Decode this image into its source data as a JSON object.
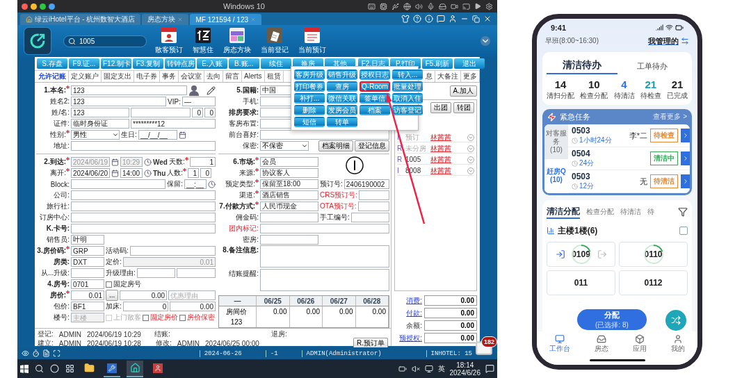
{
  "mac_bar": {
    "title": "Windows 10"
  },
  "app_tabs": [
    {
      "label": "绿云iHotel平台 - 杭州数智大酒店",
      "selected": false
    },
    {
      "label": "房态方块",
      "selected": false
    },
    {
      "label": "MF 121594 / 123",
      "selected": true
    }
  ],
  "header": {
    "search": "1005",
    "apps": [
      "散客预订",
      "智慧住",
      "房态方块",
      "当前登记",
      "当前预订"
    ]
  },
  "toolbar": {
    "left": [
      "S.存盘",
      "F9.证...",
      "F12.制卡",
      "F3.复制",
      "转钟点房",
      "E.入账",
      "B.账...",
      "续住",
      "换房",
      "其他"
    ],
    "right": [
      "F2.日志",
      "P.打印",
      "F5.刷新",
      "退出"
    ]
  },
  "subtabs": {
    "left": [
      {
        "label": "允许记账",
        "selected": true
      },
      {
        "label": "定义账户",
        "selected": false
      },
      {
        "label": "固定支出",
        "selected": false
      },
      {
        "label": "电子券",
        "selected": false
      },
      {
        "label": "事务",
        "selected": false
      },
      {
        "label": "会议室",
        "selected": false
      },
      {
        "label": "去向",
        "selected": false
      },
      {
        "label": "留言",
        "selected": false
      },
      {
        "label": "Alerts",
        "selected": false
      },
      {
        "label": "租赁",
        "selected": false
      }
    ],
    "right": [
      {
        "label": "息",
        "selected": false
      },
      {
        "label": "大备注",
        "selected": false
      },
      {
        "label": "更多",
        "selected": false
      }
    ]
  },
  "form": {
    "left": [
      [
        [
          {
            "kind": "label",
            "text": "1.本名:",
            "bold": true,
            "required": true
          },
          {
            "kind": "input",
            "value": "123"
          },
          {
            "kind": "avatar"
          },
          {
            "kind": "pen"
          }
        ],
        [
          {
            "kind": "label",
            "text": "姓名2:"
          },
          {
            "kind": "input",
            "value": "123"
          },
          {
            "kind": "label",
            "text": "VIP:"
          },
          {
            "kind": "short",
            "value": "—"
          }
        ],
        [
          {
            "kind": "label",
            "text": "姓/名:"
          },
          {
            "kind": "medium",
            "value": "123"
          },
          {
            "kind": "input"
          },
          {
            "kind": "num",
            "value": "0"
          },
          {
            "kind": "num",
            "value": "0"
          }
        ],
        [
          {
            "kind": "label",
            "text": "证件:"
          },
          {
            "kind": "medium",
            "value": "临时身份证"
          },
          {
            "kind": "input",
            "value": "*********12"
          }
        ],
        [
          {
            "kind": "label",
            "text": "性别:",
            "required": true
          },
          {
            "kind": "select",
            "value": "男性"
          },
          {
            "kind": "label",
            "text": "生日:"
          },
          {
            "kind": "date",
            "value": "__/__/__"
          },
          {
            "kind": "calendar"
          }
        ],
        [
          {
            "kind": "label",
            "text": "地址:"
          },
          {
            "kind": "input"
          }
        ]
      ],
      [
        [
          {
            "kind": "label",
            "text": "2.到达:",
            "bold": true,
            "required": true
          },
          {
            "kind": "date",
            "value": "2024/06/19",
            "disabled": true
          },
          {
            "kind": "calendar"
          },
          {
            "kind": "time",
            "value": "10:29",
            "disabled": true
          },
          {
            "kind": "clock"
          },
          {
            "kind": "text",
            "text": "Wed"
          },
          {
            "kind": "label",
            "text": "天数:",
            "required": true
          },
          {
            "kind": "amount",
            "value": "1"
          }
        ],
        [
          {
            "kind": "label",
            "text": "离开:",
            "required": true
          },
          {
            "kind": "date",
            "value": "2024/06/20"
          },
          {
            "kind": "calendar"
          },
          {
            "kind": "time",
            "value": "14:00"
          },
          {
            "kind": "clock"
          },
          {
            "kind": "text",
            "text": "Thu"
          },
          {
            "kind": "label",
            "text": "人数:",
            "required": true
          },
          {
            "kind": "num",
            "value": "1"
          },
          {
            "kind": "num",
            "value": "0"
          }
        ],
        [
          {
            "kind": "label",
            "text": "Block:"
          },
          {
            "kind": "input"
          },
          {
            "kind": "label",
            "text": "保留:"
          },
          {
            "kind": "time",
            "value": "__:__"
          },
          {
            "kind": "clock"
          }
        ],
        [
          {
            "kind": "label",
            "text": "公司:"
          },
          {
            "kind": "input"
          }
        ],
        [
          {
            "kind": "label",
            "text": "旅行社:"
          },
          {
            "kind": "input"
          }
        ],
        [
          {
            "kind": "label",
            "text": "订房中心:"
          },
          {
            "kind": "input"
          }
        ],
        [
          {
            "kind": "label",
            "text": "K.卡号:",
            "bold": true
          },
          {
            "kind": "input"
          }
        ],
        [
          {
            "kind": "label",
            "text": "销售员:"
          },
          {
            "kind": "short",
            "value": "叶明"
          }
        ],
        [
          {
            "kind": "label",
            "text": "3.房价码:",
            "bold": true,
            "required": true
          },
          {
            "kind": "short",
            "value": "GRP"
          },
          {
            "kind": "label",
            "text": "活动码:"
          },
          {
            "kind": "input"
          }
        ],
        [
          {
            "kind": "label",
            "text": "房类:",
            "bold": true
          },
          {
            "kind": "short",
            "value": "DXT"
          },
          {
            "kind": "label",
            "text": "定价:"
          },
          {
            "kind": "amount",
            "value": "0.01",
            "disabled": true
          }
        ],
        [
          {
            "kind": "label",
            "text": "从...升级:"
          },
          {
            "kind": "short"
          },
          {
            "kind": "label",
            "text": "升级理由:"
          },
          {
            "kind": "input"
          },
          {
            "kind": "input"
          }
        ],
        [
          {
            "kind": "label",
            "text": "4.房号:",
            "bold": true
          },
          {
            "kind": "short",
            "value": "0701"
          },
          {
            "kind": "check",
            "label": "固定房号",
            "checked": false
          }
        ],
        [
          {
            "kind": "label",
            "text": "房价:",
            "bold": true,
            "required": true
          },
          {
            "kind": "short_amount",
            "value": "0.01"
          },
          {
            "kind": "button",
            "text": "..."
          },
          {
            "kind": "amount",
            "value": "0.00"
          },
          {
            "kind": "input",
            "placeholder": "优惠理由"
          }
        ],
        [
          {
            "kind": "label",
            "text": "包价:"
          },
          {
            "kind": "short",
            "value": "BF1"
          },
          {
            "kind": "label",
            "text": "加床:"
          },
          {
            "kind": "amount",
            "value": "0"
          },
          {
            "kind": "amount",
            "value": "0.00"
          }
        ],
        [
          {
            "kind": "label",
            "text": "楼号:"
          },
          {
            "kind": "short",
            "placeholder": "主楼",
            "disabled": true
          },
          {
            "kind": "check",
            "label": "上门散客",
            "checked": false,
            "disabled": true
          },
          {
            "kind": "check",
            "label": "固定房价",
            "checked": false,
            "red": true
          },
          {
            "kind": "check",
            "label": "房价保密",
            "checked": false,
            "red": true
          }
        ]
      ]
    ],
    "middle": [
      [
        [
          {
            "kind": "label",
            "text": "5.国籍:",
            "bold": true
          },
          {
            "kind": "input",
            "value": "中国"
          }
        ],
        [
          {
            "kind": "label",
            "text": "手机:"
          },
          {
            "kind": "input"
          }
        ],
        [
          {
            "kind": "label",
            "text": "排房要求:",
            "bold": true
          },
          {
            "kind": "input"
          }
        ],
        [
          {
            "kind": "label",
            "text": "客房布置:"
          },
          {
            "kind": "input"
          }
        ],
        [
          {
            "kind": "label",
            "text": "前台喜好:"
          },
          {
            "kind": "input"
          }
        ],
        [
          {
            "kind": "label",
            "text": "保密:"
          },
          {
            "kind": "select",
            "value": "不保密"
          },
          {
            "kind": "spacer"
          },
          {
            "kind": "button",
            "text": "档案明细"
          },
          {
            "kind": "button",
            "text": "登记信息"
          }
        ]
      ],
      [
        [
          {
            "kind": "label",
            "text": "6.市场:",
            "bold": true,
            "required": true
          },
          {
            "kind": "medium",
            "value": "会员"
          },
          {
            "kind": "spacer"
          },
          {
            "kind": "circle"
          },
          {
            "kind": "spacer"
          }
        ],
        [
          {
            "kind": "label",
            "text": "来源:",
            "required": true
          },
          {
            "kind": "medium",
            "value": "协议客人"
          }
        ],
        [
          {
            "kind": "label",
            "text": "预定类型:",
            "required": true
          },
          {
            "kind": "medium",
            "value": "保留至18:00"
          },
          {
            "kind": "label",
            "text": "预订号:"
          },
          {
            "kind": "input",
            "value": "2406190002"
          }
        ],
        [
          {
            "kind": "label",
            "text": "渠道:",
            "required": true
          },
          {
            "kind": "medium",
            "value": "酒店销售"
          },
          {
            "kind": "label",
            "text": "CRS预订号:",
            "red": true
          },
          {
            "kind": "input"
          }
        ],
        [
          {
            "kind": "label",
            "text": "7.付款方式:",
            "bold": true,
            "required": true
          },
          {
            "kind": "medium",
            "value": "人民币现金"
          },
          {
            "kind": "label",
            "text": "OTA预订号:",
            "red": true
          },
          {
            "kind": "input"
          }
        ],
        [
          {
            "kind": "label",
            "text": "佣金码:"
          },
          {
            "kind": "medium"
          },
          {
            "kind": "label",
            "text": "手工编号:"
          },
          {
            "kind": "input"
          }
        ],
        [
          {
            "kind": "label",
            "text": "团内标记:",
            "red": true
          },
          {
            "kind": "input"
          }
        ],
        [
          {
            "kind": "label",
            "text": "密房:"
          },
          {
            "kind": "medium"
          }
        ],
        [
          {
            "kind": "label",
            "text": "8.备注信息:",
            "bold": true
          },
          {
            "kind": "textarea"
          }
        ],
        [
          {
            "kind": "label",
            "text": "结账提醒:"
          },
          {
            "kind": "textarea"
          }
        ]
      ]
    ],
    "rate_table": {
      "columns": [
        "—",
        "06/25",
        "06/26",
        "06/27",
        "06/28"
      ],
      "rows": [
        [
          "房间价",
          "0.00",
          "0.00",
          "0.00",
          "0.00"
        ],
        [
          "123"
        ]
      ]
    },
    "footer": {
      "rows": [
        [
          {
            "label": "登记:",
            "user": "ADMIN",
            "time": "2024/06/19 10:29"
          },
          {
            "label": "结账:"
          },
          {
            "label": "退房:"
          }
        ],
        [
          {
            "label": "建立:",
            "user": "ADMIN",
            "time": "2024/06/19 10:28"
          },
          {
            "label": "修改:",
            "user": "ADMIN",
            "time": "2024/06/25 00:00"
          }
        ]
      ],
      "button": "R.预订单"
    }
  },
  "side_panel": {
    "add_button": "A.加人",
    "group_buttons": [
      "出团",
      "转团"
    ],
    "members": [
      {
        "code": "I",
        "room": "预订",
        "name": "林茜茜",
        "disabled": true
      },
      {
        "code": "R",
        "room": "未分房",
        "name": "林茜茜",
        "disabled": true
      },
      {
        "code": "R",
        "room": "1005",
        "name": "林茜茜",
        "disabled": false
      },
      {
        "code": "I",
        "room": "8008",
        "name": "林茜茜",
        "disabled": false
      }
    ],
    "totals": [
      {
        "label": "消费:",
        "value": "0.00",
        "link": true
      },
      {
        "label": "付款:",
        "value": "0.00",
        "link": true
      },
      {
        "label": "余额:",
        "value": "0.00",
        "link": false
      },
      {
        "label": "预授权:",
        "value": "0.00",
        "link": true
      }
    ]
  },
  "popup": [
    {
      "label": "客房升级",
      "highlighted": false
    },
    {
      "label": "销售升级",
      "highlighted": false
    },
    {
      "label": "授权日志",
      "highlighted": false
    },
    {
      "label": "转入...",
      "highlighted": false
    },
    {
      "label": "打印餐券",
      "highlighted": false
    },
    {
      "label": "查房",
      "highlighted": false
    },
    {
      "label": "Q-Room",
      "highlighted": true
    },
    {
      "label": "批量处理",
      "highlighted": false
    },
    {
      "label": "补打...",
      "highlighted": false
    },
    {
      "label": "微信关联",
      "highlighted": false
    },
    {
      "label": "签单信",
      "highlighted": false
    },
    {
      "label": "取消入住",
      "highlighted": false
    },
    {
      "label": "删除",
      "highlighted": false
    },
    {
      "label": "发房会员",
      "highlighted": false
    },
    {
      "label": "档案",
      "highlighted": false
    },
    {
      "label": "访客登记",
      "highlighted": false
    },
    {
      "label": "短信",
      "highlighted": false
    },
    {
      "label": "转单",
      "highlighted": false
    }
  ],
  "status_bar": [
    "2024-06-26",
    "-1",
    "ADMIN(Administrator)",
    "INHOTEL: 15"
  ],
  "mail_badge": "182",
  "taskbar": {
    "ime": "英",
    "time": "18:14",
    "date": "2024/6/26"
  },
  "phone": {
    "time": "9:41",
    "shift": "早班(8:00~16:30)",
    "scope": "我管理的",
    "tabs": [
      {
        "label": "清洁待办",
        "selected": true
      },
      {
        "label": "工单待办",
        "selected": false
      }
    ],
    "stats": [
      {
        "value": "14",
        "label": "清扫分配",
        "color": "#222222"
      },
      {
        "value": "10",
        "label": "检查分配",
        "color": "#222222"
      },
      {
        "value": "4",
        "label": "待清洁",
        "color": "#2f6fe0"
      },
      {
        "value": "21",
        "label": "待检查",
        "color": "#1a9fa8"
      },
      {
        "value": "21",
        "label": "已完成",
        "color": "#222222"
      }
    ],
    "urgent": {
      "title": "紧急任务",
      "more": "查看更多 >",
      "categories": [
        {
          "label": "对客服务",
          "count": "(10)",
          "selected": true
        },
        {
          "label": "赶房Q",
          "count": "(10)",
          "selected": false
        }
      ],
      "tasks": [
        {
          "room": "0503",
          "duration": "1小时24分",
          "guest": "李*二",
          "status": "待检查",
          "color": "#e08a3c"
        },
        {
          "room": "0504",
          "duration": "24分",
          "status": "清洁中",
          "color": "#3aa65a"
        },
        {
          "room": "0503",
          "duration": "12分",
          "guest": "无",
          "status": "待清洁",
          "color": "#e08a3c"
        }
      ]
    },
    "assign_tabs": [
      {
        "label": "清洁分配",
        "selected": true
      },
      {
        "label": "检查分配",
        "selected": false
      },
      {
        "label": "待清洁",
        "selected": false
      },
      {
        "label": "待",
        "selected": false
      }
    ],
    "floor": {
      "label": "主楼1楼(6)",
      "checked": false
    },
    "rooms": [
      {
        "number": "0109",
        "kind": "inout"
      },
      {
        "number": "0110",
        "kind": "ring"
      },
      {
        "number": "011",
        "kind": "plain"
      },
      {
        "number": "0112",
        "kind": "plain"
      }
    ],
    "fab": {
      "label": "分配",
      "sub": "(已选择: 8)"
    },
    "nav": [
      {
        "label": "工作台",
        "selected": true
      },
      {
        "label": "房态",
        "selected": false
      },
      {
        "label": "应用",
        "selected": false
      },
      {
        "label": "我的",
        "selected": false
      }
    ]
  }
}
